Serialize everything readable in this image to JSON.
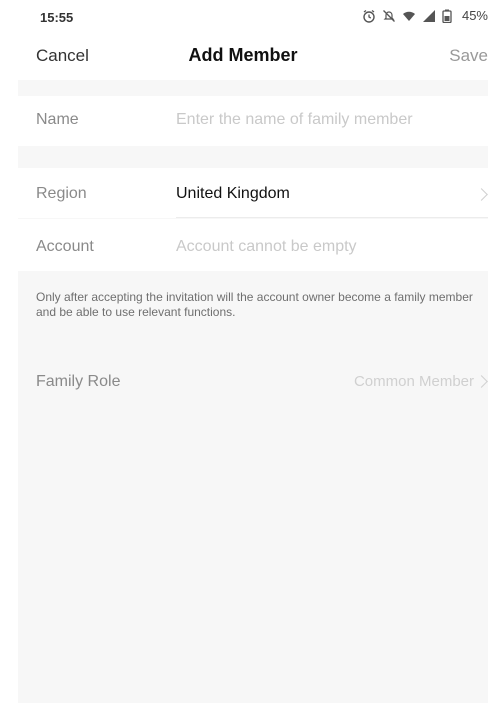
{
  "status_bar": {
    "time": "15:55",
    "battery": "45%",
    "icons": [
      "alarm-icon",
      "mute-icon",
      "wifi-icon",
      "signal-icon",
      "battery-icon"
    ]
  },
  "nav": {
    "cancel_label": "Cancel",
    "title": "Add Member",
    "save_label": "Save"
  },
  "form": {
    "name": {
      "label": "Name",
      "placeholder": "Enter the name of family member"
    },
    "region": {
      "label": "Region",
      "value": "United Kingdom"
    },
    "account": {
      "label": "Account",
      "placeholder": "Account cannot be empty"
    },
    "hint": "Only after accepting the invitation will the account owner become a family member and be able to use relevant functions.",
    "role": {
      "label": "Family Role",
      "value": "Common Member"
    }
  },
  "colors": {
    "background": "#f7f7f7",
    "row_background": "#ffffff",
    "placeholder": "#c9c9c9",
    "label": "#8a8a8a"
  }
}
